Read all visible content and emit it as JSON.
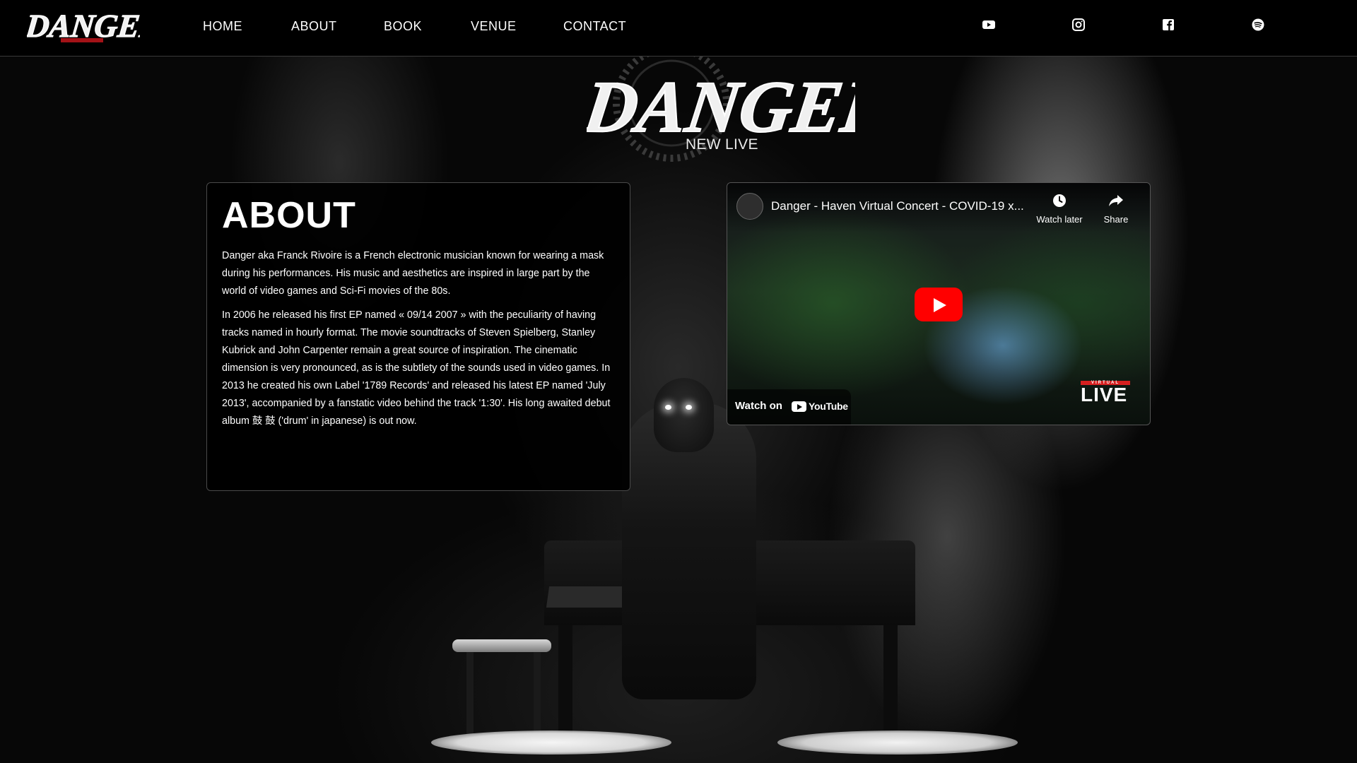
{
  "nav": {
    "logo_text": "DANGER",
    "items": [
      {
        "label": "HOME"
      },
      {
        "label": "ABOUT"
      },
      {
        "label": "BOOK"
      },
      {
        "label": "VENUE"
      },
      {
        "label": "CONTACT"
      }
    ],
    "social": [
      "youtube-icon",
      "instagram-icon",
      "facebook-icon",
      "spotify-icon"
    ]
  },
  "hero": {
    "logo_text": "DANGER",
    "subtitle": "NEW LIVE"
  },
  "about": {
    "title": "ABOUT",
    "paragraphs": [
      "Danger aka Franck Rivoire is a French electronic musician known for wearing a mask during his performances. His music and aesthetics are inspired in large part by the world of video games and Sci-Fi movies of the 80s.",
      "In 2006 he released his first EP named « 09/14 2007 » with the peculiarity of having tracks named in hourly format. The movie soundtracks of Steven Spielberg, Stanley Kubrick and John Carpenter remain a great source of inspiration. The cinematic dimension is very pronounced, as is the subtlety of the sounds used in video games. In 2013 he created his own Label '1789 Records' and released his latest EP named 'July 2013', accompanied by a fanstatic video behind the track '1:30'. His long awaited debut album 鼓 鼓 ('drum' in japanese) is out now."
    ]
  },
  "video": {
    "title": "Danger - Haven Virtual Concert - COVID-19 x...",
    "watch_later": "Watch later",
    "share": "Share",
    "watch_on": "Watch on",
    "youtube_wordmark": "YouTube",
    "badge_small": "VIRTUAL",
    "badge_word": "LIVE"
  },
  "colors": {
    "background": "#000000",
    "accent_red": "#ff0000",
    "text": "#ffffff"
  }
}
